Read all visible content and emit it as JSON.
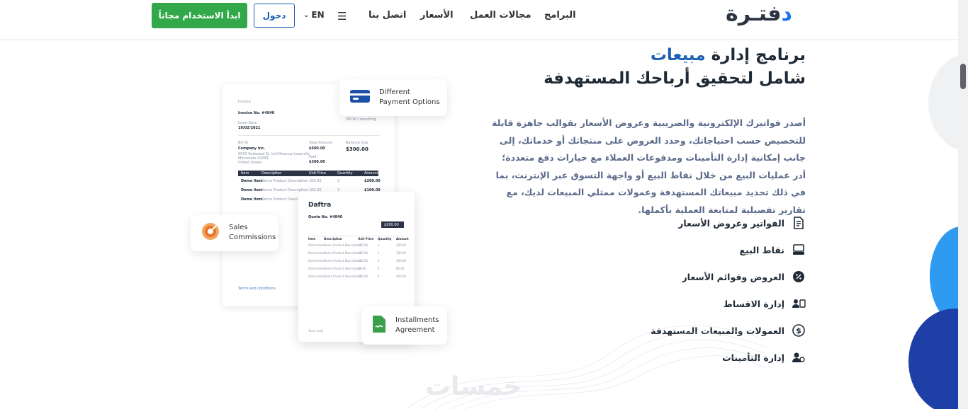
{
  "header": {
    "logo": {
      "main": "فتـرة",
      "accent": "د"
    },
    "nav": [
      "البرامج",
      "مجالات العمل",
      "الأسعار",
      "اتصل بنا"
    ],
    "lang": "EN",
    "login_label": "دخول",
    "start_label": "ابدأ الاستخدام مجاناً"
  },
  "hero": {
    "title_prefix": "برنامج إدارة ",
    "title_highlight": "مبيعات",
    "title_line2": "شامل لتحقيق أرباحك المستهدفة",
    "description": "أصدر فواتيرك الإلكترونية والضريبية وعروض الأسعار بقوالب جاهزة قابلة للتخصيص حسب احتياجاتك، وحدد العروض على منتجاتك أو خدماتك، إلى جانب إمكانية إدارة التأمينات ومدفوعات العملاء مع خيارات دفع متعددة؛ أدر عمليات البيع من خلال نقاط البيع أو واجهة التسوق عبر الإنترنت، بما في ذلك تحديد مبيعاتك المستهدفة وعمولات ممثلي المبيعات لديك، مع تقارير تفصيلية لمتابعة العملية بأكملها."
  },
  "features": [
    {
      "label": "الفواتير وعروض الأسعار",
      "icon": "invoice-icon"
    },
    {
      "label": "نقاط البيع",
      "icon": "pos-icon"
    },
    {
      "label": "العروض وقوائم الأسعار",
      "icon": "discount-icon"
    },
    {
      "label": "إدارة الاقساط",
      "icon": "installments-icon"
    },
    {
      "label": "العمولات والمبيعات المستهدفة",
      "icon": "commission-icon"
    },
    {
      "label": "إدارة التأمينات",
      "icon": "insurance-icon"
    }
  ],
  "illustration": {
    "card_payment": [
      "Different",
      "Payment Options"
    ],
    "card_sales": [
      "Sales",
      "Commissions"
    ],
    "card_installments": [
      "Installments",
      "Agreement"
    ],
    "doc1": {
      "title": "Invoice",
      "number": "Invoice No. #4840",
      "issue_label": "Issue Date",
      "issue_date": "10/02/2021",
      "company_from": "SPCW Consulting",
      "bill_to": "Bill To",
      "company": "Company Inc.",
      "address": [
        "9503 Redwood St. Unit/Avenue Lowmills",
        "Minnesota 42081",
        "United States"
      ],
      "total_label": "Total Amount",
      "total": "$600.00",
      "balance_label": "Balance Due",
      "balance": "$300.00",
      "paid_label": "Paid",
      "paid": "$300.00",
      "columns": [
        "Item",
        "Description",
        "Unit Price",
        "Quantity",
        "Amount"
      ],
      "rows": [
        [
          "Demo Item",
          "Demo Product Description",
          "100.00",
          "2",
          "$200.00"
        ],
        [
          "Demo Item",
          "Demo Product Description",
          "100.00",
          "2",
          "$100.00"
        ],
        [
          "Demo Item",
          "Demo Product Description",
          "",
          "",
          ""
        ]
      ],
      "terms": "Terms and conditions"
    },
    "doc2": {
      "brand": "Daftra",
      "number": "Quote No. #4840",
      "total": "$200.00",
      "columns": [
        "Item",
        "Description",
        "Unit Price",
        "Quantity",
        "Amount"
      ],
      "rows": [
        [
          "Demo Item",
          "Demo Product Description",
          "100.00",
          "2",
          "200.00"
        ],
        [
          "Demo Item",
          "Demo Product Description",
          "100.00",
          "1",
          "100.00"
        ],
        [
          "Demo Item",
          "Demo Product Description",
          "100.00",
          "3",
          "300.00"
        ],
        [
          "Demo Item",
          "Demo Product Description",
          "20.00",
          "4",
          "80.00"
        ],
        [
          "Demo Item",
          "Demo Product Description",
          "100.00",
          "4",
          "400.00"
        ]
      ],
      "signature": "Yours truly"
    }
  },
  "watermark": "خمسات"
}
